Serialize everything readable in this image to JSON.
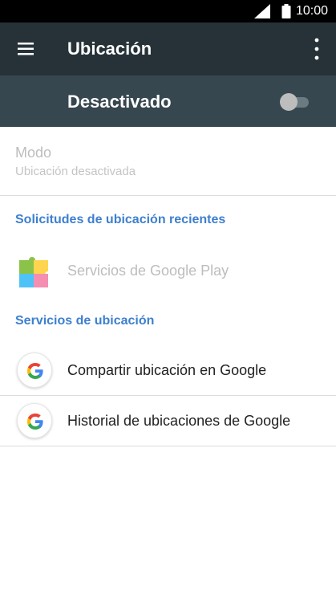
{
  "status_bar": {
    "time": "10:00",
    "icons": [
      "signal-icon",
      "battery-icon"
    ]
  },
  "app_bar": {
    "title": "Ubicación",
    "icons": [
      "menu-icon",
      "more-vert-icon"
    ],
    "background": "#263238"
  },
  "master_switch": {
    "label": "Desactivado",
    "checked": false,
    "background": "#37474f"
  },
  "mode": {
    "title": "Modo",
    "summary": "Ubicación desactivada"
  },
  "recent_requests": {
    "header": "Solicitudes de ubicación recientes",
    "items": [
      {
        "label": "Servicios de Google Play",
        "icon": "google-play-services-icon"
      }
    ]
  },
  "location_services": {
    "header": "Servicios de ubicación",
    "items": [
      {
        "label": "Compartir ubicación en Google",
        "icon": "google-icon"
      },
      {
        "label": "Historial de ubicaciones de Google",
        "icon": "google-icon"
      }
    ]
  },
  "colors": {
    "accent": "#3d7fcf",
    "disabled_text": "#bdbdbd"
  }
}
